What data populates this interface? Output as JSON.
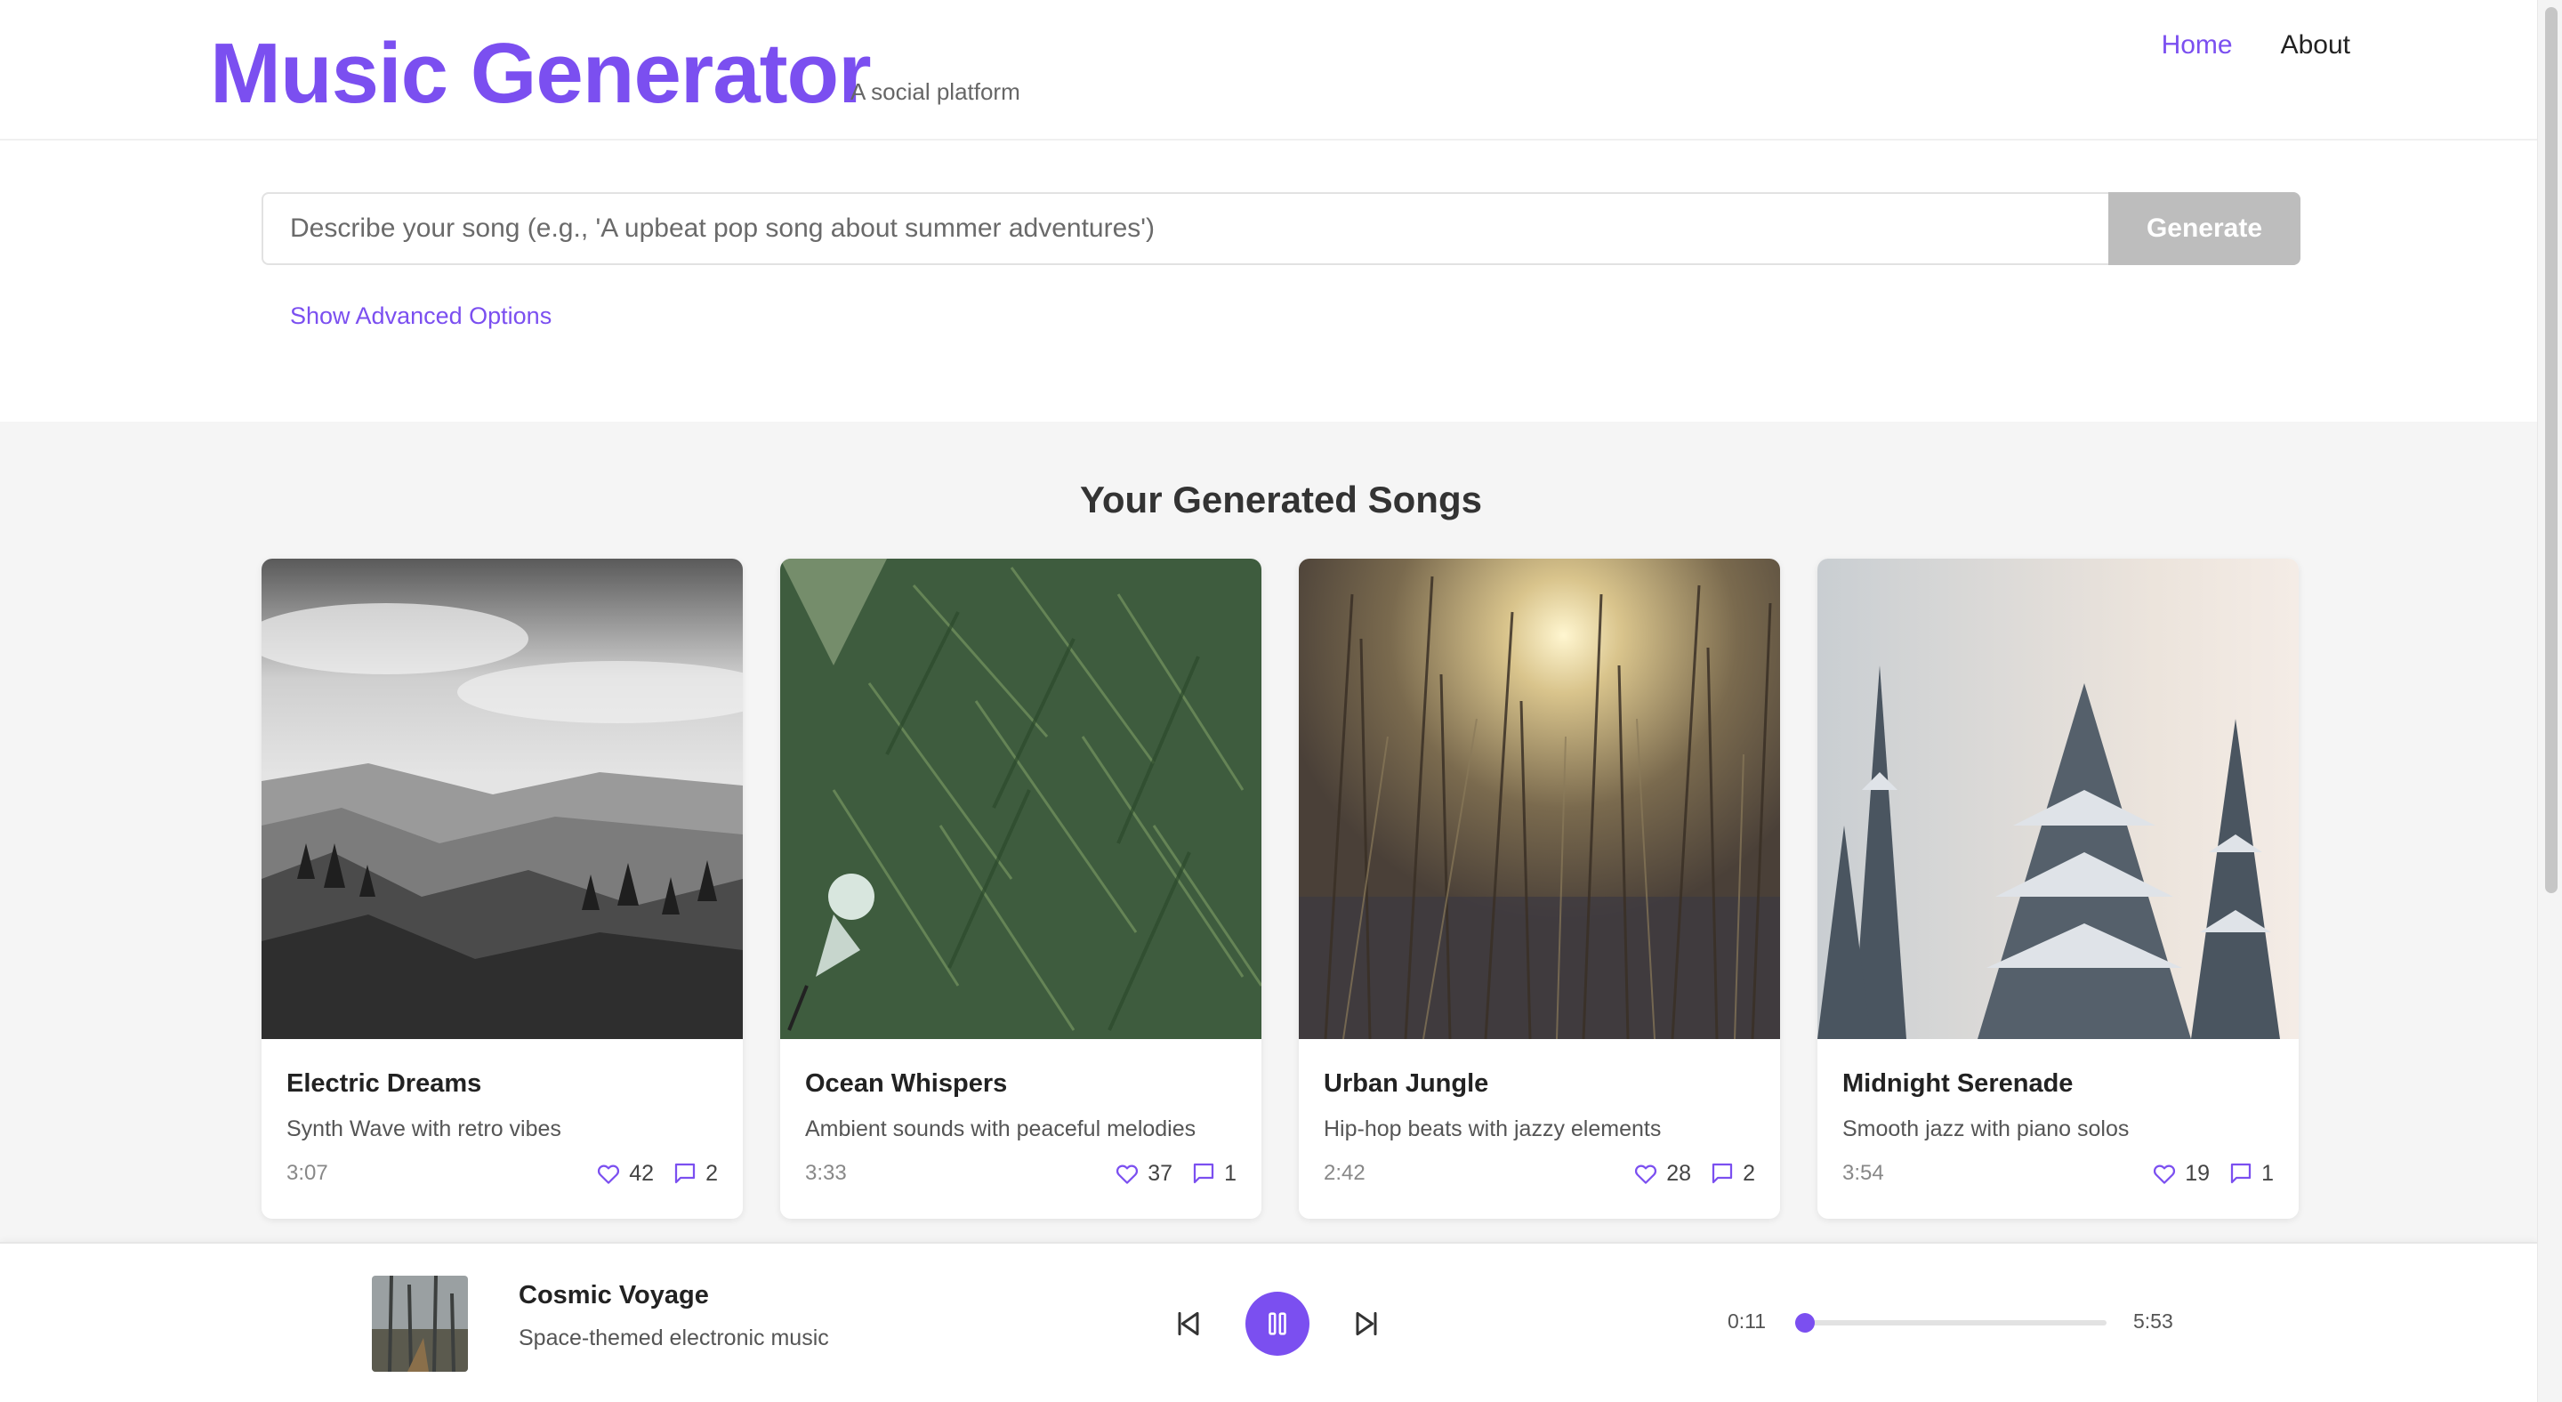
{
  "header": {
    "title": "Music Generator",
    "subtitle": "A social platform",
    "nav": [
      {
        "label": "Home",
        "active": true
      },
      {
        "label": "About",
        "active": false
      }
    ]
  },
  "prompt": {
    "placeholder": "Describe your song (e.g., 'A upbeat pop song about summer adventures')",
    "value": "",
    "generate_label": "Generate",
    "advanced_label": "Show Advanced Options"
  },
  "songs_section": {
    "title": "Your Generated Songs",
    "songs": [
      {
        "title": "Electric Dreams",
        "description": "Synth Wave with retro vibes",
        "duration": "3:07",
        "likes": "42",
        "comments": "2",
        "image": "black-and-white mountain valley with pine forest"
      },
      {
        "title": "Ocean Whispers",
        "description": "Ambient sounds with peaceful melodies",
        "duration": "3:33",
        "likes": "37",
        "comments": "1",
        "image": "dense green pine branches with cyclist"
      },
      {
        "title": "Urban Jungle",
        "description": "Hip-hop beats with jazzy elements",
        "duration": "2:42",
        "likes": "28",
        "comments": "2",
        "image": "tall grass with sunlight"
      },
      {
        "title": "Midnight Serenade",
        "description": "Smooth jazz with piano solos",
        "duration": "3:54",
        "likes": "19",
        "comments": "1",
        "image": "snowy pine trees in mist"
      }
    ]
  },
  "player": {
    "title": "Cosmic Voyage",
    "description": "Space-themed electronic music",
    "current_time": "0:11",
    "total_time": "5:53",
    "progress": 0.031,
    "state": "playing"
  },
  "icons": {
    "like": "heart-icon",
    "comment": "comment-icon",
    "previous": "skip-back-icon",
    "pause": "pause-icon",
    "next": "skip-forward-icon"
  },
  "colors": {
    "accent": "#7b4ff0",
    "generate_disabled": "#bdbdbd",
    "section_bg": "#f5f5f5"
  }
}
